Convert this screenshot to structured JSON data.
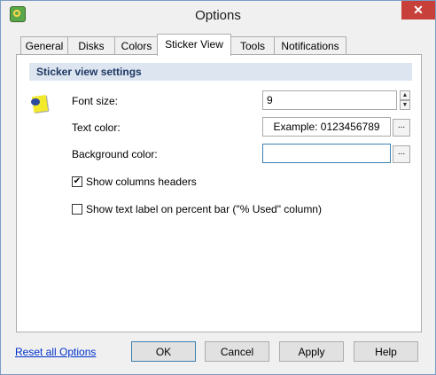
{
  "window": {
    "title": "Options",
    "close_label": "✕"
  },
  "tabs": [
    "General",
    "Disks",
    "Colors",
    "Sticker View",
    "Tools",
    "Notifications"
  ],
  "active_tab": "Sticker View",
  "section": {
    "title": "Sticker view settings"
  },
  "icons": {
    "app": "app-icon",
    "sticker": "sticker-note-icon",
    "close": "close-icon"
  },
  "fields": {
    "font_size_label": "Font size:",
    "font_size_value": "9",
    "text_color_label": "Text color:",
    "text_color_example": "Example: 0123456789",
    "background_color_label": "Background color:",
    "background_color_value": "",
    "browse_label": "...",
    "spin_up": "▲",
    "spin_down": "▼"
  },
  "checkboxes": [
    {
      "label": "Show columns headers",
      "checked": true
    },
    {
      "label": "Show text label on percent bar (\"% Used\" column)",
      "checked": false
    }
  ],
  "footer": {
    "reset_link": "Reset all Options",
    "ok": "OK",
    "cancel": "Cancel",
    "apply": "Apply",
    "help": "Help"
  },
  "check_mark": "✔"
}
